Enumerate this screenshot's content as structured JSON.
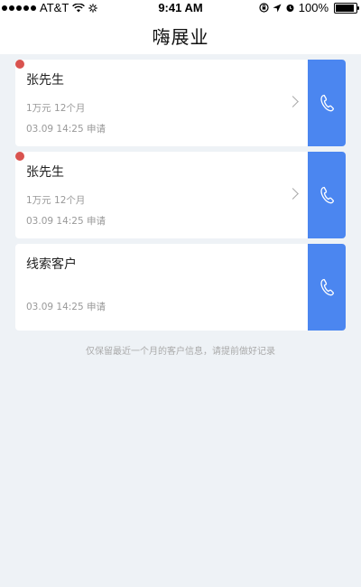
{
  "status_bar": {
    "carrier": "AT&T",
    "time": "9:41 AM",
    "battery": "100%"
  },
  "nav": {
    "title": "嗨展业"
  },
  "cards": [
    {
      "name": "张先生",
      "amount": "1万元 12个月",
      "applied": "03.09  14:25 申请",
      "unread": true,
      "has_arrow": true
    },
    {
      "name": "张先生",
      "amount": "1万元 12个月",
      "applied": "03.09  14:25 申请",
      "unread": true,
      "has_arrow": true
    },
    {
      "name": "线索客户",
      "amount": "",
      "applied": "03.09  14:25 申请",
      "unread": false,
      "has_arrow": false
    }
  ],
  "footer_note": "仅保留最近一个月的客户信息，请提前做好记录",
  "colors": {
    "accent": "#4b86f0",
    "unread_dot": "#d9534f",
    "background": "#eef2f6"
  },
  "icons": {
    "call": "phone-icon",
    "chevron": "chevron-right-icon"
  }
}
